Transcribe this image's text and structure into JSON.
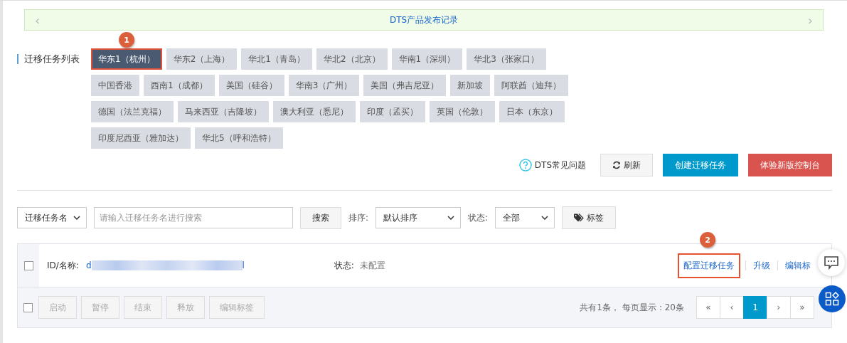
{
  "banner": {
    "prev": "‹",
    "title": "DTS产品发布记录",
    "next": "›"
  },
  "region_section": {
    "label": "迁移任务列表",
    "rows": [
      [
        {
          "label": "华东1（杭州）",
          "selected": true
        },
        {
          "label": "华东2（上海）",
          "selected": false
        },
        {
          "label": "华北1（青岛）",
          "selected": false
        },
        {
          "label": "华北2（北京）",
          "selected": false
        },
        {
          "label": "华南1（深圳）",
          "selected": false
        },
        {
          "label": "华北3（张家口）",
          "selected": false
        }
      ],
      [
        {
          "label": "中国香港",
          "selected": false
        },
        {
          "label": "西南1（成都）",
          "selected": false
        },
        {
          "label": "美国（硅谷）",
          "selected": false
        },
        {
          "label": "华南3（广州）",
          "selected": false
        },
        {
          "label": "美国（弗吉尼亚）",
          "selected": false
        },
        {
          "label": "新加坡",
          "selected": false
        },
        {
          "label": "阿联酋（迪拜）",
          "selected": false
        }
      ],
      [
        {
          "label": "德国（法兰克福）",
          "selected": false
        },
        {
          "label": "马来西亚（吉隆坡）",
          "selected": false
        },
        {
          "label": "澳大利亚（悉尼）",
          "selected": false
        },
        {
          "label": "印度（孟买）",
          "selected": false
        },
        {
          "label": "英国（伦敦）",
          "selected": false
        },
        {
          "label": "日本（东京）",
          "selected": false
        }
      ],
      [
        {
          "label": "印度尼西亚（雅加达）",
          "selected": false
        },
        {
          "label": "华北5（呼和浩特）",
          "selected": false
        }
      ]
    ]
  },
  "callouts": [
    "1",
    "2"
  ],
  "actions": {
    "help": "DTS常见问题",
    "refresh": "刷新",
    "create": "创建迁移任务",
    "new_console": "体验新版控制台"
  },
  "filters": {
    "field_select": "迁移任务名",
    "search_placeholder": "请输入迁移任务名进行搜索",
    "search_button": "搜索",
    "sort_label": "排序:",
    "sort_select": "默认排序",
    "status_label": "状态:",
    "status_select": "全部",
    "tag_button": "标签"
  },
  "task_row": {
    "checked": false,
    "id_label": "ID/名称:",
    "id_start": "d",
    "id_end": "l",
    "status_label": "状态:",
    "status": "未配置",
    "links": [
      "配置迁移任务",
      "升级",
      "编辑标"
    ]
  },
  "footer": {
    "checked": false,
    "buttons": [
      "启动",
      "暂停",
      "结束",
      "释放",
      "编辑标签"
    ],
    "summary": "共有1条， 每页显示：20条",
    "pages": [
      {
        "label": "«",
        "selected": false
      },
      {
        "label": "‹",
        "selected": false
      },
      {
        "label": "1",
        "selected": true
      },
      {
        "label": "›",
        "selected": false
      },
      {
        "label": "»",
        "selected": false
      }
    ]
  }
}
